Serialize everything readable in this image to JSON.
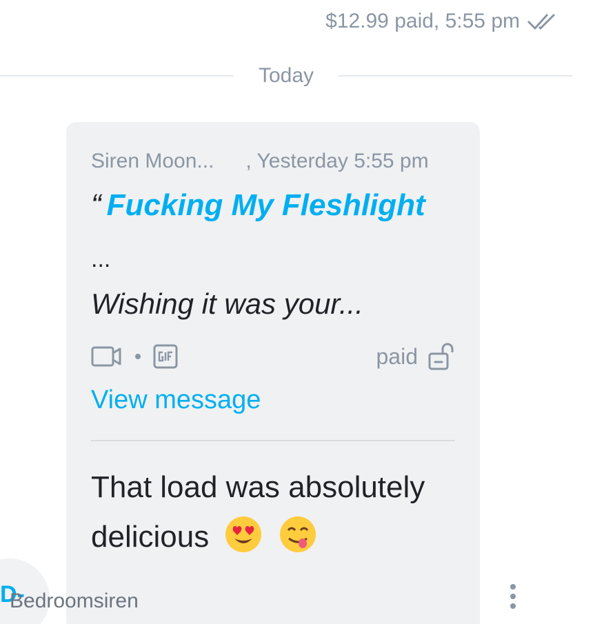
{
  "status": {
    "price_text": "$12.99 paid",
    "time": ", 5:55 pm",
    "icon": "double-check-icon"
  },
  "divider": {
    "label": "Today"
  },
  "reply_preview": {
    "sender": "Siren Moon...",
    "time": ", Yesterday 5:55 pm",
    "quote_mark": "“",
    "title": "Fucking My Fleshlight",
    "ellipsis": "...",
    "excerpt": "Wishing it was your...",
    "media_icons": [
      "video-icon",
      "gif-icon"
    ],
    "paid_label": "paid",
    "lock_icon": "unlock-icon",
    "view_link": "View message"
  },
  "message": {
    "text": "That load was absolutely delicious",
    "emojis": [
      "heart-eyes-emoji",
      "yum-emoji"
    ]
  },
  "footer": {
    "avatar_initial": "D-",
    "username": "Bedroomsiren",
    "more_icon": "more-vertical-icon"
  },
  "colors": {
    "accent": "#00aff0",
    "muted": "#8a96a3",
    "bubble": "#f0f1f3",
    "text": "#1f2327"
  }
}
